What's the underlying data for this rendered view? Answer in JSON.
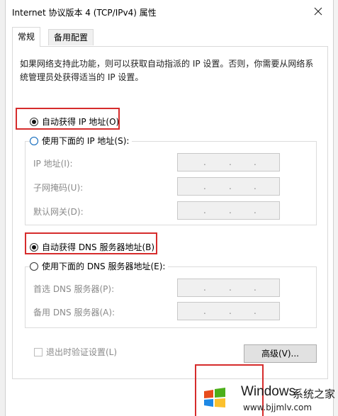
{
  "window": {
    "title": "Internet 协议版本 4 (TCP/IPv4) 属性"
  },
  "tabs": [
    {
      "label": "常规"
    },
    {
      "label": "备用配置"
    }
  ],
  "general": {
    "description": "如果网络支持此功能，则可以获取自动指派的 IP 设置。否则，你需要从网络系统管理员处获得适当的 IP 设置。",
    "ip_auto_label": "自动获得 IP 地址(O)",
    "ip_manual_label": "使用下面的 IP 地址(S):",
    "ip_address_label": "IP 地址(I):",
    "subnet_mask_label": "子网掩码(U):",
    "gateway_label": "默认网关(D):",
    "dns_auto_label": "自动获得 DNS 服务器地址(B)",
    "dns_manual_label": "使用下面的 DNS 服务器地址(E):",
    "preferred_dns_label": "首选 DNS 服务器(P):",
    "alternate_dns_label": "备用 DNS 服务器(A):",
    "validate_label": "退出时验证设置(L)",
    "advanced_label": "高级(V)...",
    "ip_auto_selected": true,
    "dns_auto_selected": true,
    "validate_checked": false
  },
  "ip_separator": ".",
  "watermark": {
    "brand": "Windows",
    "brand_suffix": "系统之家",
    "url": "www.bjjmlv.com"
  },
  "colors": {
    "highlight": "#d62c2c",
    "disabled_text": "#8a8a8a",
    "disabled_field": "#f0f0f0",
    "radio_accent": "#005fb8"
  }
}
